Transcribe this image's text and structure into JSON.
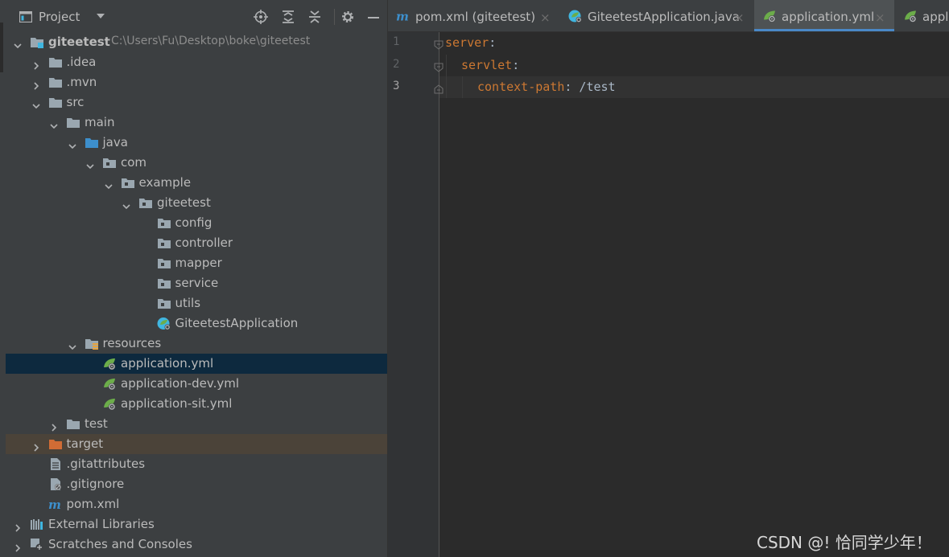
{
  "project_panel": {
    "title": "Project",
    "header_buttons": [
      "locate-icon",
      "expand-all-icon",
      "collapse-all-icon",
      "gear-icon",
      "minimize-icon"
    ],
    "tree": [
      {
        "label": "giteetest",
        "path": "C:\\Users\\Fu\\Desktop\\boke\\giteetest",
        "icon": "module-folder-icon",
        "expanded": true
      },
      {
        "label": ".idea",
        "icon": "folder-icon",
        "expanded": false
      },
      {
        "label": ".mvn",
        "icon": "folder-icon",
        "expanded": false
      },
      {
        "label": "src",
        "icon": "folder-icon",
        "expanded": true
      },
      {
        "label": "main",
        "icon": "folder-icon",
        "expanded": true
      },
      {
        "label": "java",
        "icon": "source-folder-icon",
        "expanded": true
      },
      {
        "label": "com",
        "icon": "package-icon",
        "expanded": true
      },
      {
        "label": "example",
        "icon": "package-icon",
        "expanded": true
      },
      {
        "label": "giteetest",
        "icon": "package-icon",
        "expanded": true
      },
      {
        "label": "config",
        "icon": "package-icon"
      },
      {
        "label": "controller",
        "icon": "package-icon"
      },
      {
        "label": "mapper",
        "icon": "package-icon"
      },
      {
        "label": "service",
        "icon": "package-icon"
      },
      {
        "label": "utils",
        "icon": "package-icon"
      },
      {
        "label": "GiteetestApplication",
        "icon": "spring-boot-class-icon"
      },
      {
        "label": "resources",
        "icon": "resources-folder-icon",
        "expanded": true
      },
      {
        "label": "application.yml",
        "icon": "spring-yml-icon",
        "selected": true
      },
      {
        "label": "application-dev.yml",
        "icon": "spring-yml-icon"
      },
      {
        "label": "application-sit.yml",
        "icon": "spring-yml-icon"
      },
      {
        "label": "test",
        "icon": "folder-icon",
        "expanded": false
      },
      {
        "label": "target",
        "icon": "excluded-folder-icon",
        "expanded": false
      },
      {
        "label": ".gitattributes",
        "icon": "text-file-icon"
      },
      {
        "label": ".gitignore",
        "icon": "ignore-file-icon"
      },
      {
        "label": "pom.xml",
        "icon": "maven-icon"
      },
      {
        "label": "External Libraries",
        "icon": "libraries-icon",
        "expanded": false
      },
      {
        "label": "Scratches and Consoles",
        "icon": "scratches-icon",
        "expanded": false
      }
    ]
  },
  "editor": {
    "tabs": [
      {
        "label": "pom.xml (giteetest)",
        "icon": "maven-icon",
        "active": false
      },
      {
        "label": "GiteetestApplication.java",
        "icon": "spring-boot-class-icon",
        "active": false
      },
      {
        "label": "application.yml",
        "icon": "spring-yml-icon",
        "active": true
      },
      {
        "label": "appli",
        "icon": "spring-yml-icon",
        "active": false
      }
    ],
    "line_numbers": [
      "1",
      "2",
      "3"
    ],
    "current_line": 3,
    "code": [
      {
        "key": "server",
        "colon": ":",
        "value": ""
      },
      {
        "key": "servlet",
        "colon": ":",
        "value": ""
      },
      {
        "key": "context-path",
        "colon": ":",
        "value": " /test"
      }
    ]
  },
  "colors": {
    "panel_bg": "#3c3f41",
    "editor_bg": "#2b2b2b",
    "selection": "#0d293e",
    "excluded": "#4b4339",
    "yaml_key": "#cc7832",
    "active_tab_underline": "#4a88c7"
  },
  "watermark": "CSDN @! 恰同学少年！"
}
